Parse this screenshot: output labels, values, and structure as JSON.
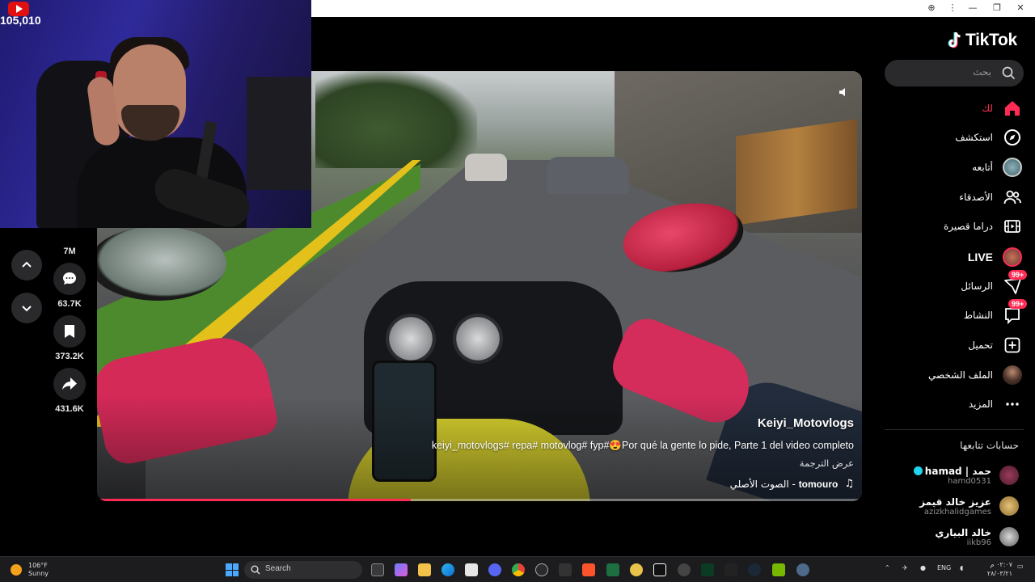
{
  "window": {
    "controls": [
      "zoom",
      "more",
      "minimize",
      "restore",
      "close"
    ]
  },
  "stream_overlay": {
    "youtube_count": "105,010"
  },
  "video": {
    "author": "Keiyi_Motovlogs",
    "caption": "keiyi_motovlogs# repa# motovlog# fyp#😍Por qué la gente lo pide, Parte 1 del video completo",
    "translate_label": "عرض الترجمة",
    "sound_artist": "tomouro",
    "sound_title": "الصوت الأصلي - ",
    "progress": 0.41
  },
  "actions": {
    "likes": "7M",
    "comments": "63.7K",
    "saves": "373.2K",
    "shares": "431.6K"
  },
  "brand": {
    "name": "TikTok",
    "accent": "#fe2c55",
    "cyan": "#25f4ee"
  },
  "search": {
    "placeholder": "بحث"
  },
  "sidebar": {
    "items": [
      {
        "label": "لك",
        "icon": "home-icon",
        "active": true
      },
      {
        "label": "استكشف",
        "icon": "compass-icon"
      },
      {
        "label": "أتابعه",
        "icon": "following-avatar-icon"
      },
      {
        "label": "الأصدقاء",
        "icon": "friends-icon"
      },
      {
        "label": "دراما قصيرة",
        "icon": "film-icon"
      },
      {
        "label": "LIVE",
        "icon": "live-avatar-icon"
      },
      {
        "label": "الرسائل",
        "icon": "messages-icon",
        "badge": "99+"
      },
      {
        "label": "النشاط",
        "icon": "activity-icon",
        "badge": "99+"
      },
      {
        "label": "تحميل",
        "icon": "upload-icon"
      },
      {
        "label": "الملف الشخصي",
        "icon": "profile-avatar-icon"
      },
      {
        "label": "المزيد",
        "icon": "more-icon"
      }
    ]
  },
  "following": {
    "title": "حسابات تتابعها",
    "accounts": [
      {
        "name": "hamad | حمد",
        "handle": "hamd0531",
        "verified": true
      },
      {
        "name": "عزيز خالد قيمز",
        "handle": "azizkhalidgames"
      },
      {
        "name": "خالد البياري",
        "handle": "iikb96"
      }
    ]
  },
  "taskbar": {
    "weather_temp": "106°F",
    "weather_desc": "Sunny",
    "search_label": "Search",
    "language": "ENG",
    "time": "٠٢:٠٧ م",
    "date": "٢٨/٠٣/٢١"
  }
}
